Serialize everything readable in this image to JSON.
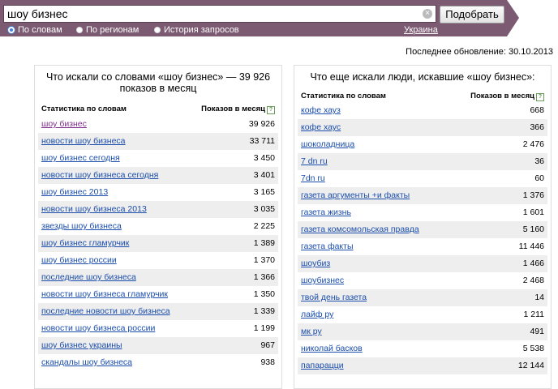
{
  "search": {
    "query": "шоу бизнес",
    "submit_label": "Подобрать"
  },
  "modes": [
    {
      "label": "По словам",
      "selected": true
    },
    {
      "label": "По регионам",
      "selected": false
    },
    {
      "label": "История запросов",
      "selected": false
    }
  ],
  "region": "Украина",
  "updated": "Последнее обновление: 30.10.2013",
  "left": {
    "title_line1": "Что искали со словами «шоу бизнес» — 39 926",
    "title_line2": "показов в месяц",
    "col_phrase": "Статистика по словам",
    "col_count": "Показов в месяц",
    "rows": [
      {
        "phrase": "шоу бизнес",
        "count": "39 926"
      },
      {
        "phrase": "новости шоу бизнеса",
        "count": "33 711"
      },
      {
        "phrase": "шоу бизнес сегодня",
        "count": "3 450"
      },
      {
        "phrase": "новости шоу бизнеса сегодня",
        "count": "3 401"
      },
      {
        "phrase": "шоу бизнес 2013",
        "count": "3 165"
      },
      {
        "phrase": "новости шоу бизнеса 2013",
        "count": "3 035"
      },
      {
        "phrase": "звезды шоу бизнеса",
        "count": "2 225"
      },
      {
        "phrase": "шоу бизнес гламурчик",
        "count": "1 389"
      },
      {
        "phrase": "шоу бизнес россии",
        "count": "1 370"
      },
      {
        "phrase": "последние шоу бизнеса",
        "count": "1 366"
      },
      {
        "phrase": "новости шоу бизнеса гламурчик",
        "count": "1 350"
      },
      {
        "phrase": "последние новости шоу бизнеса",
        "count": "1 339"
      },
      {
        "phrase": "новости шоу бизнеса россии",
        "count": "1 199"
      },
      {
        "phrase": "шоу бизнес украины",
        "count": "967"
      },
      {
        "phrase": "скандалы шоу бизнеса",
        "count": "938"
      }
    ]
  },
  "right": {
    "title": "Что еще искали люди, искавшие «шоу бизнес»:",
    "col_phrase": "Статистика по словам",
    "col_count": "Показов в месяц",
    "rows": [
      {
        "phrase": "кофе хауз",
        "count": "668"
      },
      {
        "phrase": "кофе хаус",
        "count": "366"
      },
      {
        "phrase": "шоколадница",
        "count": "2 476"
      },
      {
        "phrase": "7 dn ru",
        "count": "36"
      },
      {
        "phrase": "7dn ru",
        "count": "60"
      },
      {
        "phrase": "газета аргументы +и факты",
        "count": "1 376"
      },
      {
        "phrase": "газета жизнь",
        "count": "1 601"
      },
      {
        "phrase": "газета комсомольская правда",
        "count": "5 160"
      },
      {
        "phrase": "газета факты",
        "count": "11 446"
      },
      {
        "phrase": "шоубиз",
        "count": "1 466"
      },
      {
        "phrase": "шоубизнес",
        "count": "2 468"
      },
      {
        "phrase": "твой день газета",
        "count": "14"
      },
      {
        "phrase": "лайф ру",
        "count": "1 211"
      },
      {
        "phrase": "мк ру",
        "count": "491"
      },
      {
        "phrase": "николай басков",
        "count": "5 538"
      },
      {
        "phrase": "папарацци",
        "count": "12 144"
      }
    ]
  }
}
